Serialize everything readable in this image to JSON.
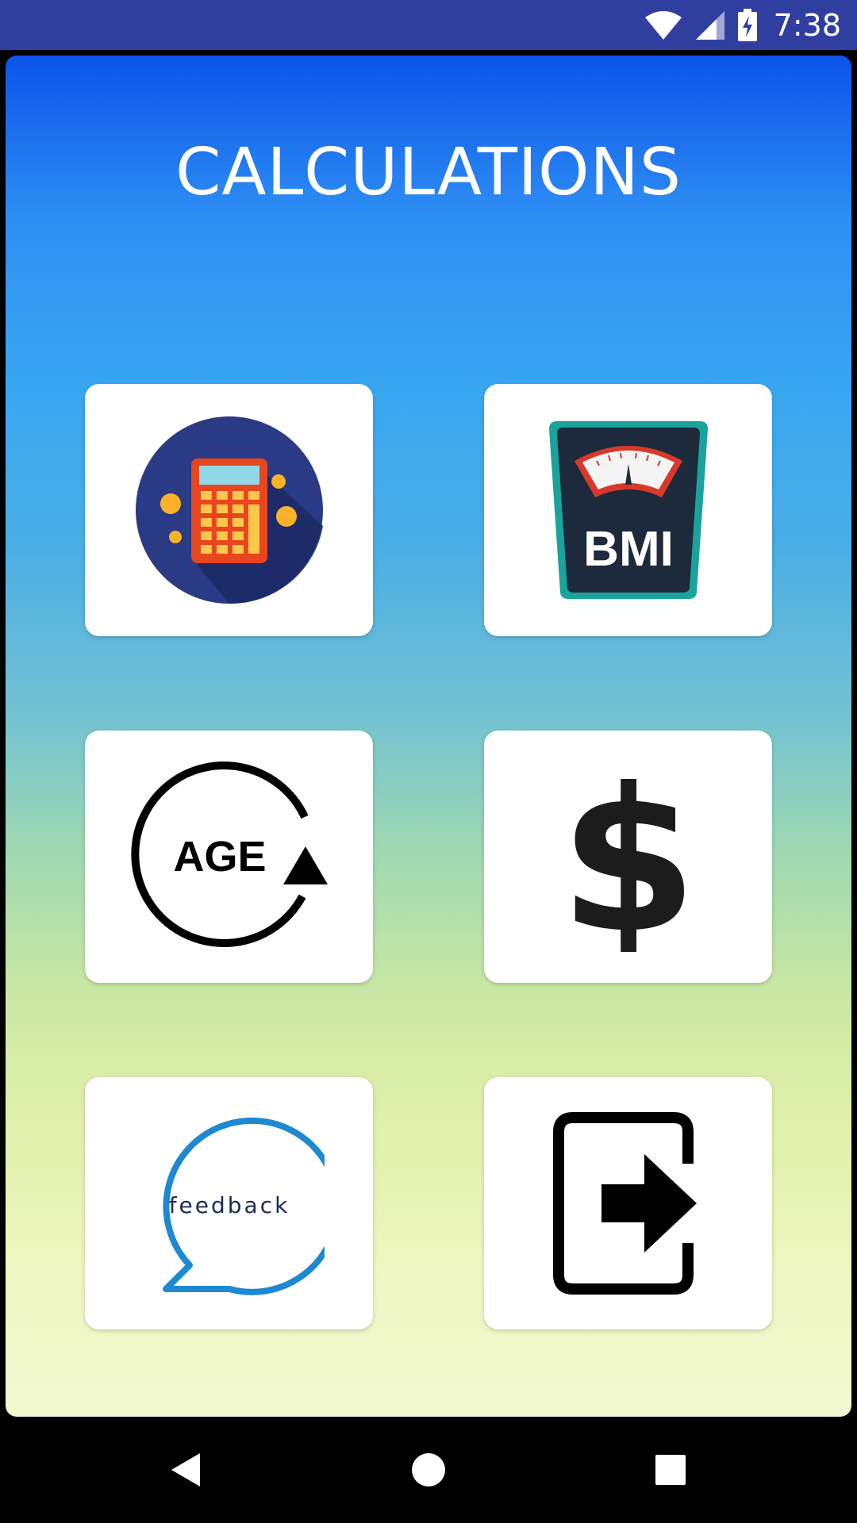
{
  "status_bar": {
    "time": "7:38",
    "icons": [
      "wifi-icon",
      "signal-icon",
      "battery-charging-icon"
    ]
  },
  "app": {
    "title": "CALCULATIONS"
  },
  "cards": [
    {
      "name": "calculator",
      "icon": "calculator-icon"
    },
    {
      "name": "bmi",
      "icon": "bmi-scale-icon",
      "text": "BMI"
    },
    {
      "name": "age",
      "icon": "age-cycle-icon",
      "text": "AGE"
    },
    {
      "name": "currency",
      "icon": "dollar-icon",
      "text": "$"
    },
    {
      "name": "feedback",
      "icon": "feedback-bubble-icon",
      "text": "feedback"
    },
    {
      "name": "exit",
      "icon": "exit-icon"
    }
  ],
  "colors": {
    "status_bar": "#303f9f",
    "gradient_top": "#0d53ea",
    "gradient_bottom": "#f3f8d2",
    "card": "#ffffff",
    "feedback_blue": "#1e88d0",
    "bmi_teal": "#1aa39a",
    "bmi_dark": "#1d2a3b"
  },
  "nav_bar": {
    "buttons": [
      "back-icon",
      "home-icon",
      "recents-icon"
    ]
  }
}
